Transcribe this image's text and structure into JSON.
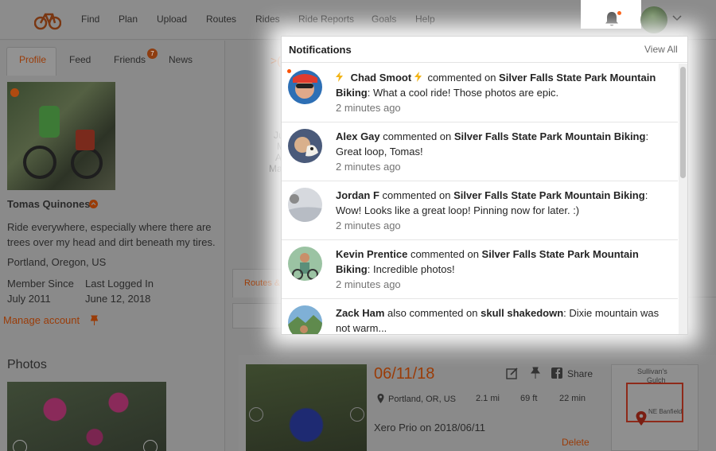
{
  "nav": {
    "items": [
      "Find",
      "Plan",
      "Upload",
      "Routes",
      "Rides",
      "Ride Reports",
      "Goals",
      "Help"
    ],
    "icons": {
      "logo": "bike-logo-icon",
      "bell": "bell-icon",
      "chevron": "chevron-down-icon"
    },
    "accent_color": "#fc5200"
  },
  "profile": {
    "tabs": [
      "Profile",
      "Feed",
      "Friends",
      "News"
    ],
    "friends_badge": "7",
    "name": "Tomas Quinones",
    "bio": "Ride everywhere, especially where there are trees over my head and dirt beneath my tires.",
    "location": "Portland, Oregon, US",
    "member_since_label": "Member Since",
    "member_since_value": "July 2011",
    "last_logged_label": "Last Logged In",
    "last_logged_value": "June 12, 2018",
    "manage_account": "Manage account",
    "photos_title": "Photos"
  },
  "center": {
    "fragments": [
      ">(",
      "Ju",
      "M",
      "A",
      "Ma"
    ],
    "routes_tab": "Routes &"
  },
  "ride_card": {
    "date": "06/11/18",
    "share": "Share",
    "location": "Portland, OR, US",
    "distance": "2.1 mi",
    "elevation": "69 ft",
    "duration": "22 min",
    "title": "Xero Prio on 2018/06/11",
    "delete": "Delete",
    "map_labels": [
      "Sullivan's",
      "Gulch",
      "NE Banfield"
    ]
  },
  "notifications": {
    "title": "Notifications",
    "view_all": "View All",
    "items": [
      {
        "user": "Chad Smoot",
        "has_bolts": true,
        "unread": true,
        "action": " commented on ",
        "target": "Silver Falls State Park Mountain Biking",
        "message": ": What a cool ride! Those photos are epic.",
        "time": "2 minutes ago"
      },
      {
        "user": "Alex Gay",
        "has_bolts": false,
        "unread": false,
        "action": " commented on ",
        "target": "Silver Falls State Park Mountain Biking",
        "message": ": Great loop, Tomas!",
        "time": "2 minutes ago"
      },
      {
        "user": "Jordan F",
        "has_bolts": false,
        "unread": false,
        "action": " commented on ",
        "target": "Silver Falls State Park Mountain Biking",
        "message": ": Wow! Looks like a great loop! Pinning now for later. :)",
        "time": "2 minutes ago"
      },
      {
        "user": "Kevin Prentice",
        "has_bolts": false,
        "unread": false,
        "action": " commented on ",
        "target": "Silver Falls State Park Mountain Biking",
        "message": ": Incredible photos!",
        "time": "2 minutes ago"
      },
      {
        "user": "Zack Ham",
        "has_bolts": false,
        "unread": false,
        "action": " also commented on ",
        "target": "skull shakedown",
        "message": ": Dixie mountain was not warm...",
        "time": ""
      }
    ]
  }
}
